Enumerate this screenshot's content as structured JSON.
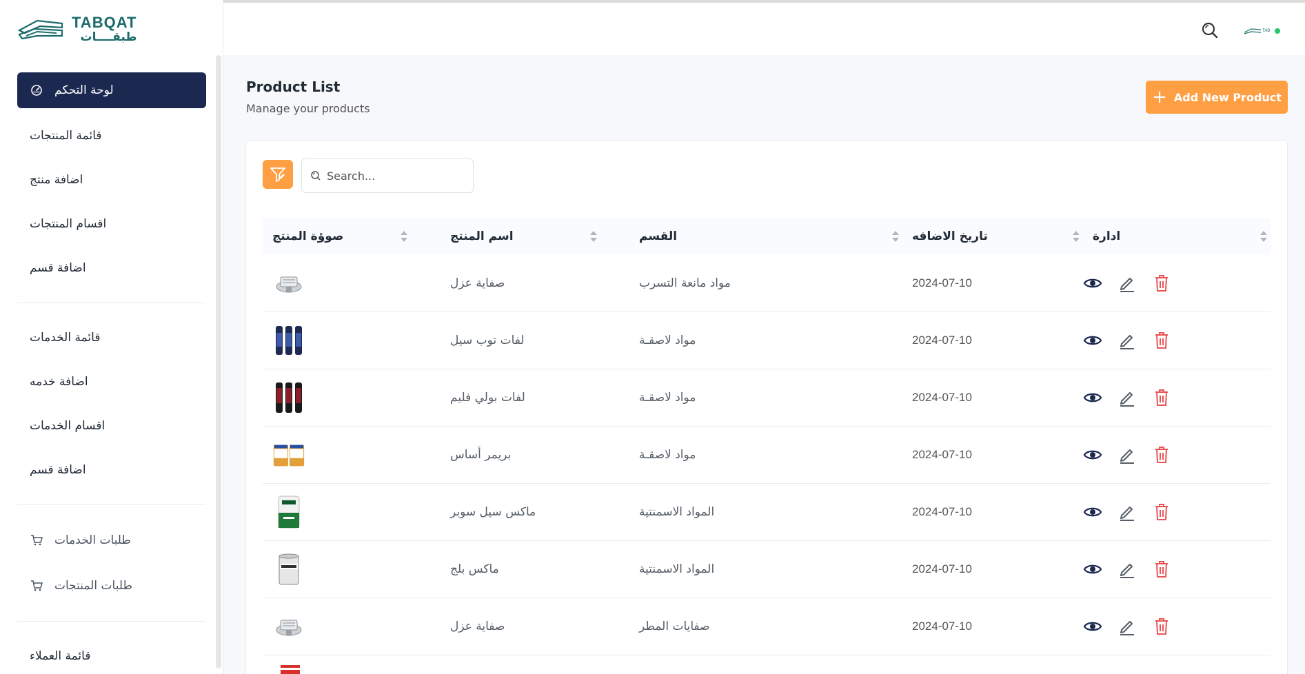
{
  "brand": {
    "name_en": "TABQAT",
    "name_ar": "طبقــــات"
  },
  "sidebar": {
    "items": [
      {
        "label": "لوحة التحكم",
        "active": true,
        "icon": "dashboard-gauge-icon"
      },
      {
        "label": "قائمة المنتجات"
      },
      {
        "label": "اضافة منتج"
      },
      {
        "label": "اقسام المنتجات"
      },
      {
        "label": "اضافة قسم"
      },
      {
        "label": "قائمة الخدمات"
      },
      {
        "label": "اضافة خدمه"
      },
      {
        "label": "اقسام الخدمات"
      },
      {
        "label": "اضافة قسم"
      },
      {
        "label": "طلبات الخدمات",
        "icon": "cart-icon"
      },
      {
        "label": "طلبات المنتجات",
        "icon": "cart-icon"
      },
      {
        "label": "قائمة العملاء"
      }
    ]
  },
  "header": {
    "search_icon": "search-icon",
    "avatar_icon": "user-avatar-logo"
  },
  "page": {
    "title": "Product List",
    "subtitle": "Manage your products",
    "add_button": "Add New Product"
  },
  "search": {
    "placeholder": "Search..."
  },
  "table": {
    "columns": [
      "صوؤة المنتج",
      "اسم المنتج",
      "القسم",
      "تاريخ الاضافه",
      "ادارة"
    ],
    "rows": [
      {
        "image": "drain-grate",
        "name": "صفاية عزل",
        "category": "مواد مانعة التسرب",
        "date": "2024-07-10"
      },
      {
        "image": "sealant-rolls-blue",
        "name": "لفات توب سيل",
        "category": "مواد لاصقـة",
        "date": "2024-07-10"
      },
      {
        "image": "sealant-rolls-black",
        "name": "لفات بولي فليم",
        "category": "مواد لاصقـة",
        "date": "2024-07-10"
      },
      {
        "image": "primer-buckets",
        "name": "بريمر أساس",
        "category": "مواد لاصقـة",
        "date": "2024-07-10"
      },
      {
        "image": "maxseal-bag",
        "name": "ماكس سيل سوبر",
        "category": "المواد الاسمنتية",
        "date": "2024-07-10"
      },
      {
        "image": "maxplug-bucket",
        "name": "ماكس بلج",
        "category": "المواد الاسمنتية",
        "date": "2024-07-10"
      },
      {
        "image": "drain-grate",
        "name": "صفاية عزل",
        "category": "صفايات المطر",
        "date": "2024-07-10"
      }
    ]
  },
  "colors": {
    "primary_dark": "#1b2850",
    "accent": "#ff9f43",
    "delete": "#ea5455",
    "brand_teal": "#1b6b6b"
  }
}
